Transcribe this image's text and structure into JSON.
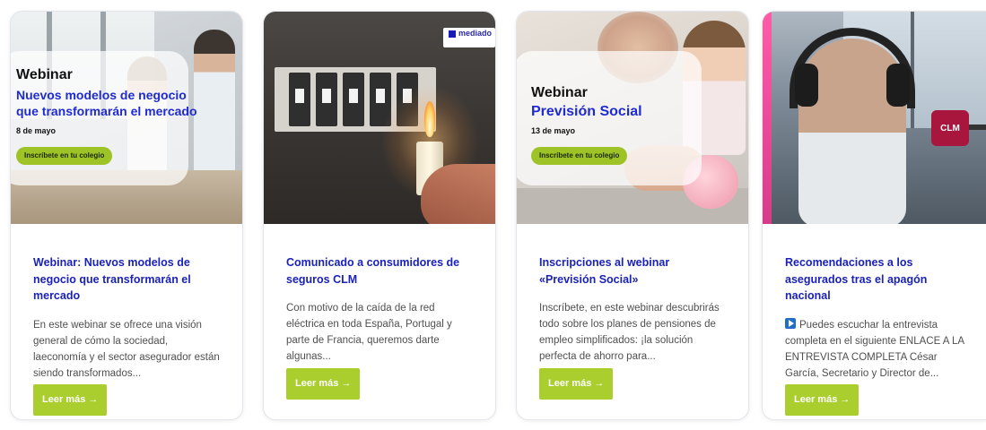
{
  "cards": [
    {
      "image_overlay": {
        "label": "Webinar",
        "title": "Nuevos modelos de negocio que transformarán el mercado",
        "date": "8 de mayo",
        "cta": "Inscríbete en tu colegio"
      },
      "title": "Webinar: Nuevos modelos de negocio que transformarán el mercado",
      "excerpt": "En este webinar se ofrece una visión general de cómo la sociedad, laeconomía y el sector asegurador están siendo transformados...",
      "button": "Leer más →"
    },
    {
      "image_logo": "mediado",
      "title": "Comunicado a consumidores de seguros CLM",
      "excerpt": "Con motivo de la caída de la red eléctrica en toda España, Portugal y parte de Francia, queremos darte algunas...",
      "button": "Leer más →"
    },
    {
      "image_overlay": {
        "label": "Webinar",
        "title": "Previsión Social",
        "date": "13 de mayo",
        "cta": "Inscríbete en tu colegio"
      },
      "title": "Inscripciones al webinar «Previsión Social»",
      "excerpt": "Inscríbete, en este webinar descubrirás todo sobre los planes de pensiones de empleo simplificados: ¡la solución perfecta de ahorro para...",
      "button": "Leer más →"
    },
    {
      "image_mic_text": "CLM",
      "title": "Recomendaciones a los asegurados tras el apagón nacional",
      "excerpt": "Puedes escuchar la entrevista completa en el siguiente ENLACE A LA ENTREVISTA COMPLETA César García, Secretario y Director de...",
      "button": "Leer más →"
    }
  ],
  "colors": {
    "title_blue": "#1a22b8",
    "button_green": "#a9ce2d",
    "pill_green": "#9dc327"
  }
}
